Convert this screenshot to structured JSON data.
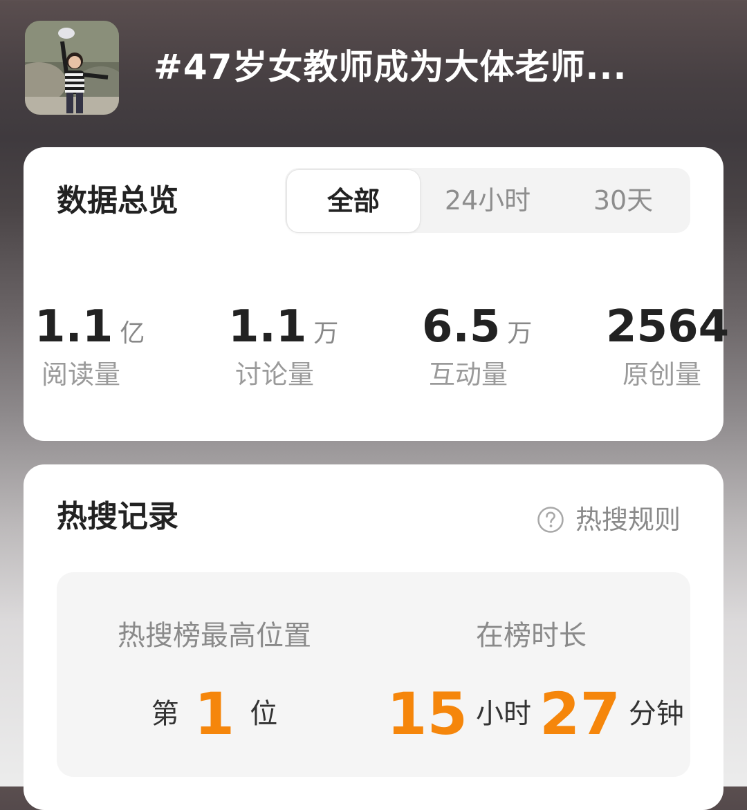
{
  "header": {
    "title": "#47岁女教师成为大体老师..."
  },
  "overview": {
    "title": "数据总览",
    "tabs": [
      {
        "label": "全部",
        "active": true
      },
      {
        "label": "24小时",
        "active": false
      },
      {
        "label": "30天",
        "active": false
      }
    ],
    "stats": [
      {
        "value": "1.1",
        "unit": "亿",
        "label": "阅读量"
      },
      {
        "value": "1.1",
        "unit": "万",
        "label": "讨论量"
      },
      {
        "value": "6.5",
        "unit": "万",
        "label": "互动量"
      },
      {
        "value": "2564",
        "unit": "",
        "label": "原创量"
      }
    ]
  },
  "hot_search": {
    "title": "热搜记录",
    "rules_icon": "help-circle-icon",
    "rules_label": "热搜规则",
    "peak": {
      "label": "热搜榜最高位置",
      "prefix": "第",
      "value": "1",
      "suffix": "位"
    },
    "duration": {
      "label": "在榜时长",
      "hours": "15",
      "hours_unit": "小时",
      "minutes": "27",
      "minutes_unit": "分钟"
    }
  },
  "colors": {
    "accent_orange": "#f5860b",
    "text_dark": "#222222",
    "text_muted": "#8a8a8a",
    "card_bg": "#ffffff",
    "segment_bg": "#f3f3f3"
  }
}
